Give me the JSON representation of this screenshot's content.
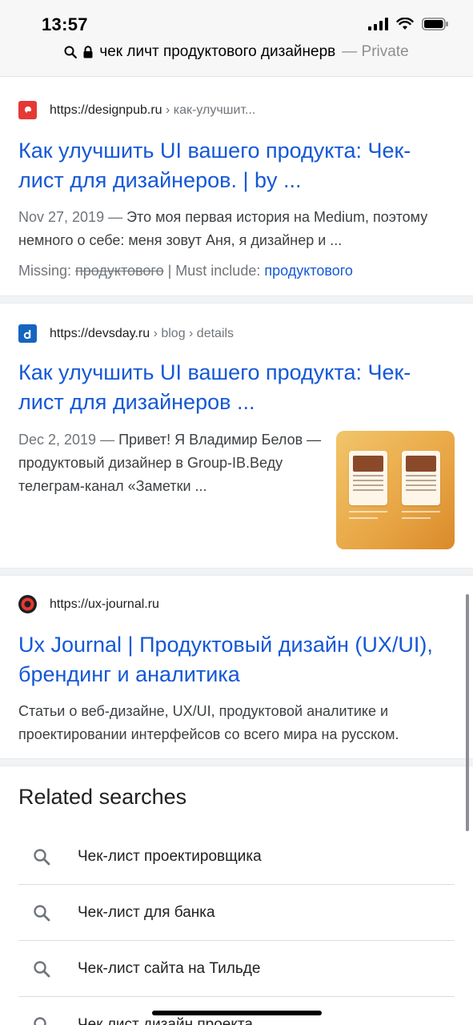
{
  "status_bar": {
    "time": "13:57"
  },
  "url_bar": {
    "query": "чек личт продуктового дизайнерв",
    "mode": "— Private"
  },
  "results": [
    {
      "url": "https://designpub.ru",
      "path": "› как-улучшит...",
      "title": "Как улучшить UI вашего продукта: Чек-лист для дизайнеров. | by ...",
      "date": "Nov 27, 2019",
      "snippet": "Это моя первая история на Medium, поэтому немного о себе: меня зовут Аня, я дизайнер и ...",
      "missing_label": "Missing:",
      "missing_word": "продуктового",
      "must_include_label": "| Must include:",
      "must_include_word": "продуктового",
      "favicon_color": "#e53935"
    },
    {
      "url": "https://devsday.ru",
      "path": "› blog › details",
      "title": "Как улучшить UI вашего продукта: Чек-лист для дизайнеров ...",
      "date": "Dec 2, 2019",
      "snippet": "Привет! Я Владимир Белов — продуктовый дизайнер в Group-IB.Веду телеграм-канал «Заметки ...",
      "favicon_color": "#1565c0"
    },
    {
      "url": "https://ux-journal.ru",
      "title": "Ux Journal | Продуктовый дизайн (UX/UI), брендинг и аналитика",
      "snippet": "Статьи о веб-дизайне, UX/UI, продуктовой аналитике и проектировании интерфейсов со всего мира на русском.",
      "favicon_color": "#e53935"
    }
  ],
  "related": {
    "heading": "Related searches",
    "items": [
      "Чек-лист проектировщика",
      "Чек-лист для банка",
      "Чек-лист сайта на Тильде",
      "Чек лист дизайн проекта"
    ]
  },
  "icons": {
    "search": "search-icon",
    "lock": "lock-icon",
    "signal": "cellular-signal-icon",
    "wifi": "wifi-icon",
    "battery": "battery-icon"
  }
}
